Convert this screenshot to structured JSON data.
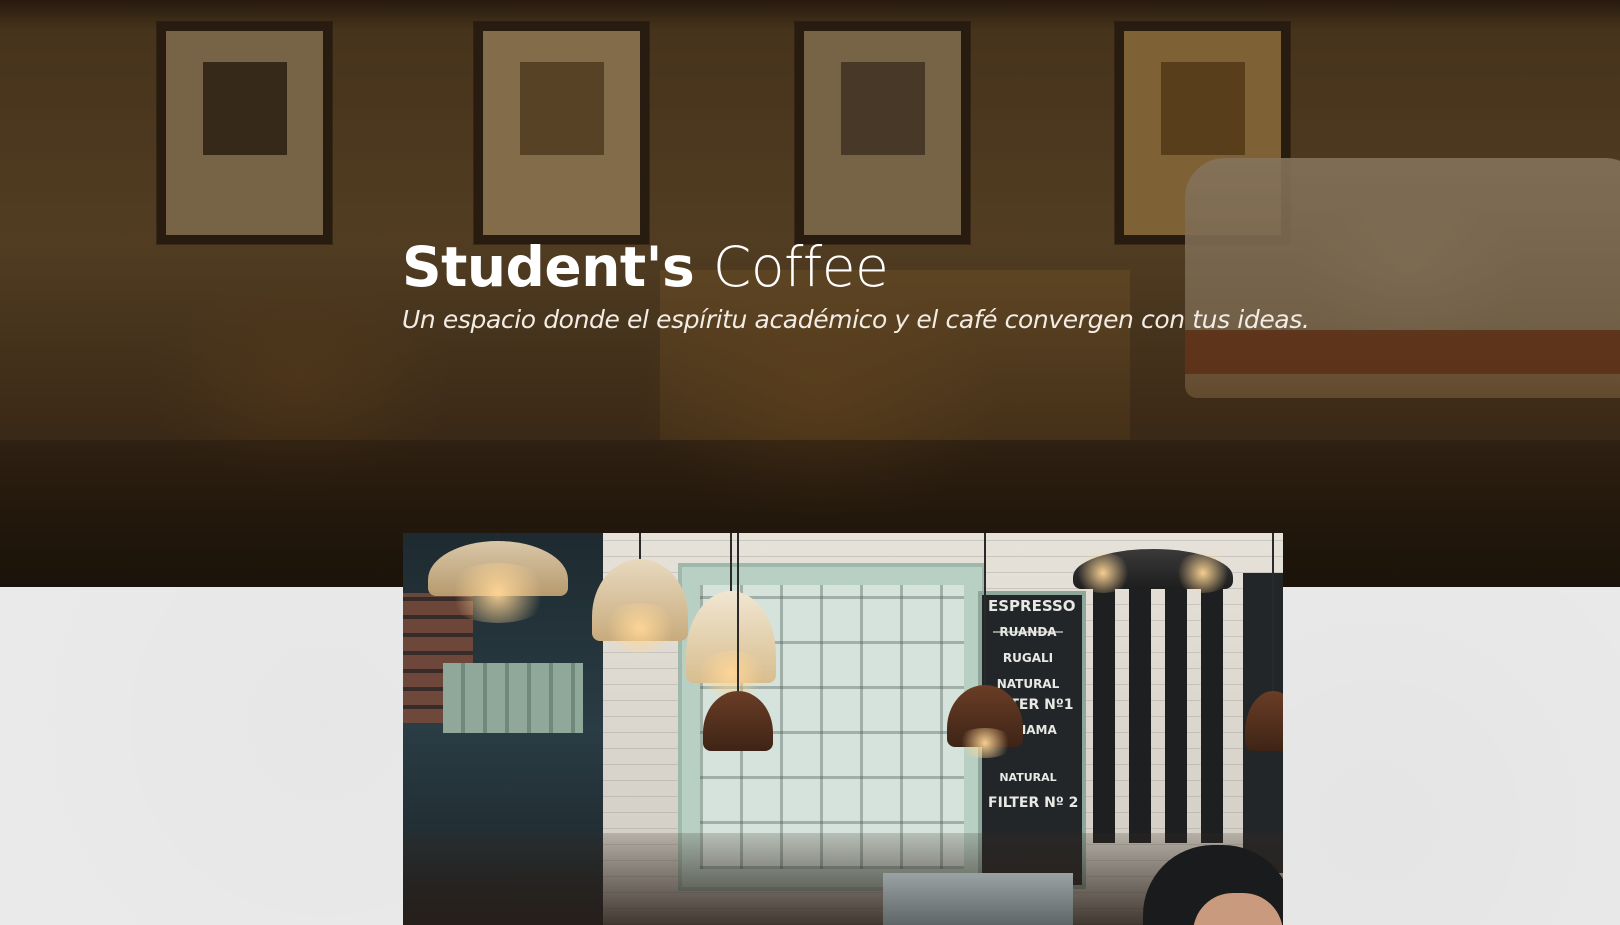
{
  "hero": {
    "title_bold": "Student's",
    "title_light": "Coffee",
    "subtitle": "Un espacio donde el espíritu académico y el café convergen con tus ideas."
  },
  "feature_photo": {
    "board_lines": [
      "ESPRESSO",
      "RUANDA",
      "RUGALI",
      "NATURAL",
      "FILTER Nº1",
      "PANAMA",
      "NATURAL",
      "FILTER Nº 2"
    ]
  },
  "colors": {
    "hero_text": "#ffffff",
    "hero_overlay": "#231608",
    "page_background": "#ececec"
  },
  "icons": []
}
